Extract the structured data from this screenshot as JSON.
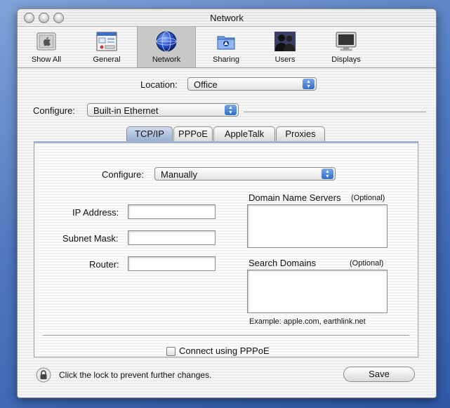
{
  "window": {
    "title": "Network"
  },
  "toolbar": {
    "items": [
      {
        "label": "Show All",
        "icon": "apple-show-all-icon"
      },
      {
        "label": "General",
        "icon": "general-prefs-icon"
      },
      {
        "label": "Network",
        "icon": "network-globe-icon",
        "selected": true
      },
      {
        "label": "Sharing",
        "icon": "sharing-folder-icon"
      },
      {
        "label": "Users",
        "icon": "users-silhouette-icon"
      },
      {
        "label": "Displays",
        "icon": "display-monitor-icon"
      }
    ]
  },
  "location": {
    "label": "Location:",
    "value": "Office"
  },
  "configure_interface": {
    "label": "Configure:",
    "value": "Built-in Ethernet"
  },
  "tabs": [
    {
      "label": "TCP/IP",
      "selected": true
    },
    {
      "label": "PPPoE"
    },
    {
      "label": "AppleTalk"
    },
    {
      "label": "Proxies"
    }
  ],
  "tcpip": {
    "configure_label": "Configure:",
    "configure_value": "Manually",
    "ip_label": "IP Address:",
    "ip_value": "",
    "subnet_label": "Subnet Mask:",
    "subnet_value": "",
    "router_label": "Router:",
    "router_value": "",
    "dns_label": "Domain Name Servers",
    "dns_optional": "(Optional)",
    "dns_value": "",
    "search_label": "Search Domains",
    "search_optional": "(Optional)",
    "search_value": "",
    "example": "Example: apple.com, earthlink.net"
  },
  "pppoe_checkbox": {
    "label": "Connect using PPPoE",
    "checked": false
  },
  "lock": {
    "text": "Click the lock to prevent further changes."
  },
  "save_button": {
    "label": "Save"
  },
  "colors": {
    "accent": "#2f6ccc",
    "desktop": "#4f78c0"
  }
}
